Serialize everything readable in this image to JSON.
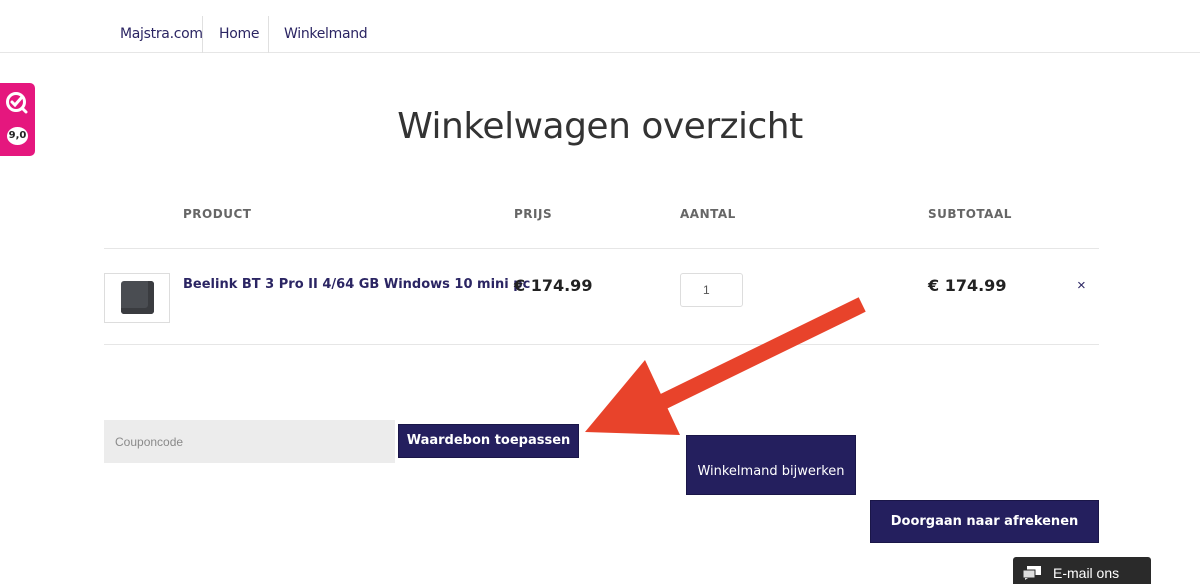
{
  "nav": {
    "items": [
      {
        "label": "Majstra.com"
      },
      {
        "label": "Home"
      },
      {
        "label": "Winkelmand"
      }
    ]
  },
  "review_widget": {
    "score": "9,0",
    "brand_color": "#e5177e"
  },
  "page_title": "Winkelwagen overzicht",
  "cart_table": {
    "headers": [
      "PRODUCT",
      "PRIJS",
      "AANTAL",
      "SUBTOTAAL"
    ],
    "rows": [
      {
        "product_name": "Beelink BT 3 Pro II 4/64 GB Windows 10 mini pc",
        "price": "€ 174.99",
        "quantity": "1",
        "subtotal": "€ 174.99",
        "remove_symbol": "×"
      }
    ]
  },
  "coupon": {
    "placeholder": "Couponcode",
    "apply_label": "Waardebon toepassen"
  },
  "actions": {
    "update_label": "Winkelmand bijwerken",
    "checkout_label": "Doorgaan naar afrekenen"
  },
  "email_widget": {
    "label": "E-mail ons"
  },
  "colors": {
    "accent": "#241f5e",
    "arrow": "#e8432b"
  }
}
